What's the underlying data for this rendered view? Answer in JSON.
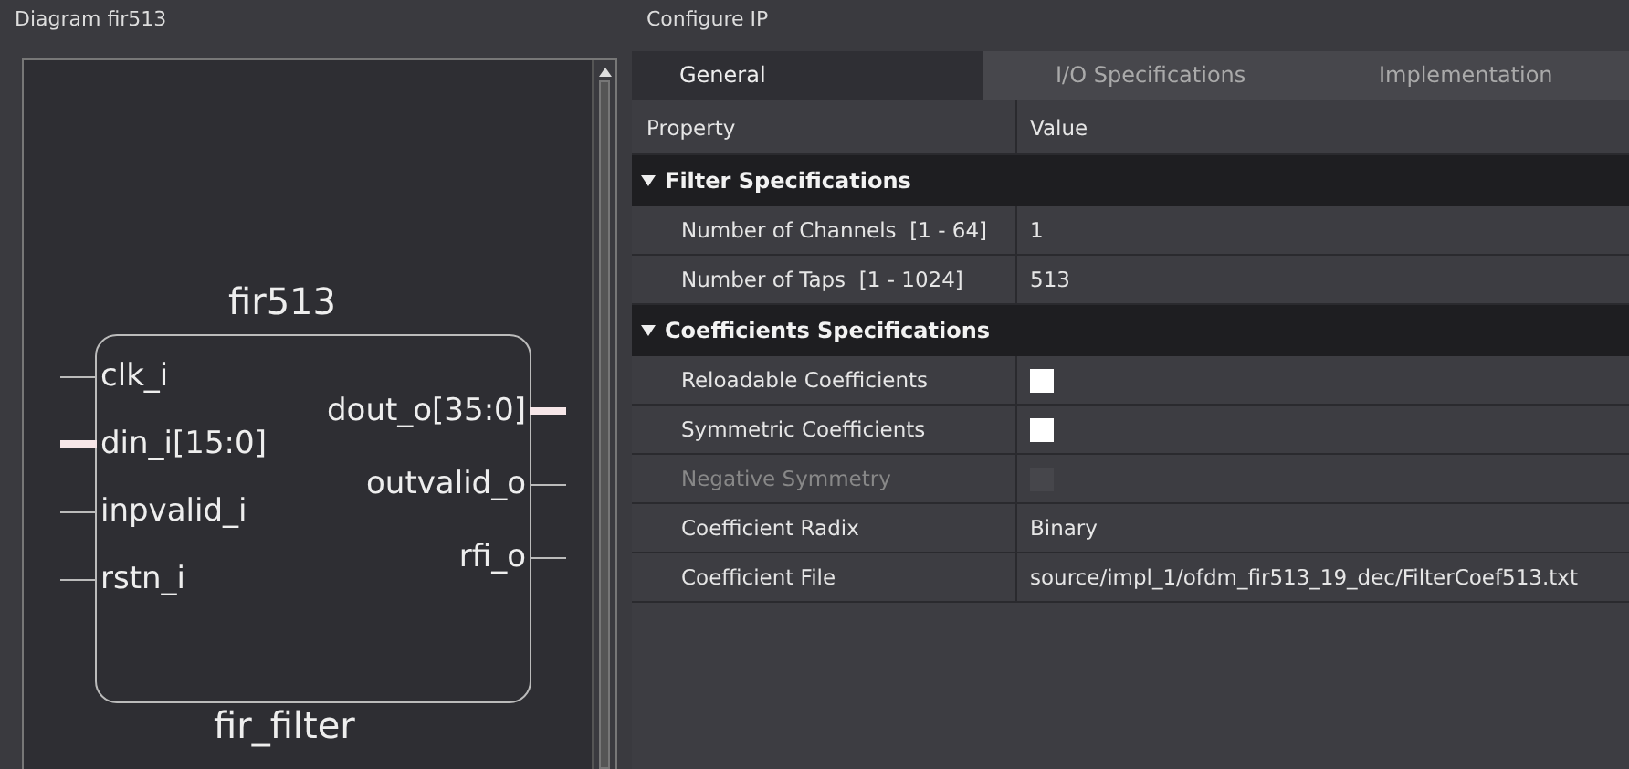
{
  "diagram_panel": {
    "title": "Diagram fir513",
    "block": {
      "instance": "fir513",
      "module": "fir_filter",
      "inputs": [
        {
          "name": "clk_i",
          "bus": false
        },
        {
          "name": "din_i[15:0]",
          "bus": true
        },
        {
          "name": "inpvalid_i",
          "bus": false
        },
        {
          "name": "rstn_i",
          "bus": false
        }
      ],
      "outputs": [
        {
          "name": "dout_o[35:0]",
          "bus": true
        },
        {
          "name": "outvalid_o",
          "bus": false
        },
        {
          "name": "rfi_o",
          "bus": false
        }
      ]
    }
  },
  "configure_panel": {
    "title": "Configure IP",
    "tabs": [
      {
        "label": "General",
        "selected": true
      },
      {
        "label": "I/O Specifications",
        "selected": false
      },
      {
        "label": "Implementation",
        "selected": false
      }
    ],
    "columns": [
      "Property",
      "Value"
    ],
    "sections": [
      {
        "title": "Filter Specifications",
        "expanded": true,
        "rows": [
          {
            "kind": "text",
            "property": "Number of Channels  [1 - 64]",
            "value": "1",
            "disabled": false
          },
          {
            "kind": "text",
            "property": "Number of Taps  [1 - 1024]",
            "value": "513",
            "disabled": false
          }
        ]
      },
      {
        "title": "Coefficients Specifications",
        "expanded": true,
        "rows": [
          {
            "kind": "checkbox",
            "property": "Reloadable Coefficients",
            "checked": false,
            "disabled": false
          },
          {
            "kind": "checkbox",
            "property": "Symmetric Coefficients",
            "checked": false,
            "disabled": false
          },
          {
            "kind": "checkbox",
            "property": "Negative Symmetry",
            "checked": false,
            "disabled": true
          },
          {
            "kind": "text",
            "property": "Coefficient Radix",
            "value": "Binary",
            "disabled": false
          },
          {
            "kind": "text",
            "property": "Coefficient File",
            "value": "source/impl_1/ofdm_fir513_19_dec/FilterCoef513.txt",
            "disabled": false
          }
        ]
      }
    ]
  }
}
